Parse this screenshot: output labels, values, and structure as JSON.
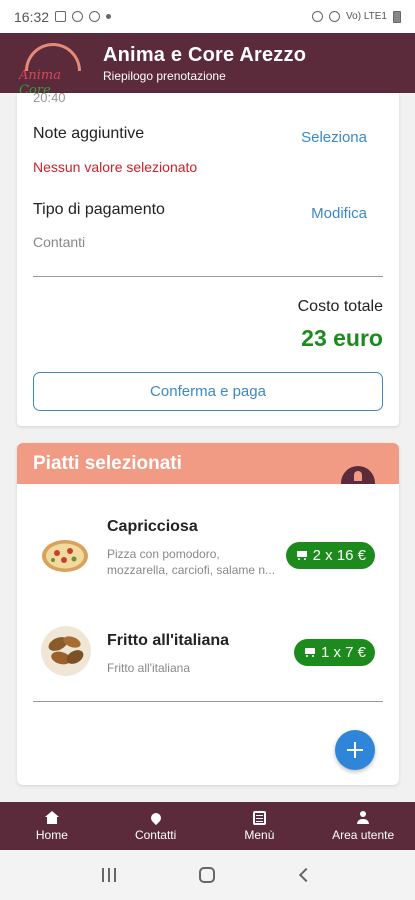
{
  "status_bar": {
    "time": "16:32",
    "signal_text": "Vo) LTE1"
  },
  "header": {
    "title": "Anima e Core Arezzo",
    "subtitle": "Riepilogo prenotazione",
    "logo_text_a": "Anima ",
    "logo_text_b": "Core"
  },
  "summary": {
    "time_partial": "20:40",
    "notes_label": "Note aggiuntive",
    "notes_action": "Seleziona",
    "notes_value": "Nessun valore selezionato",
    "payment_label": "Tipo di pagamento",
    "payment_action": "Modifica",
    "payment_value": "Contanti",
    "total_label": "Costo totale",
    "total_value": "23 euro",
    "confirm_label": "Conferma e paga"
  },
  "dishes": {
    "title": "Piatti selezionati",
    "items": [
      {
        "name": "Capricciosa",
        "description": "Pizza con pomodoro, mozzarella, carciofi, salame n...",
        "price": "2 x 16 €"
      },
      {
        "name": "Fritto all'italiana",
        "description": "Fritto all'italiana",
        "price": "1 x 7 €"
      }
    ]
  },
  "bottom_nav": {
    "items": [
      {
        "label": "Home",
        "icon": "home-icon"
      },
      {
        "label": "Contatti",
        "icon": "pin-icon"
      },
      {
        "label": "Menù",
        "icon": "menu-icon"
      },
      {
        "label": "Area utente",
        "icon": "user-icon"
      }
    ]
  },
  "colors": {
    "brand": "#5b2a3b",
    "accent_salmon": "#f19b85",
    "price_green": "#1d8a1d",
    "link_blue": "#3d88c5",
    "error_red": "#d0202a"
  }
}
